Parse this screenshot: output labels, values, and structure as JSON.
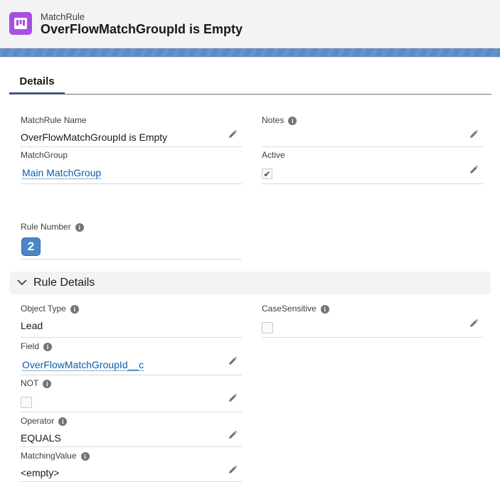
{
  "header": {
    "object_type": "MatchRule",
    "record_title": "OverFlowMatchGroupId is Empty",
    "icon": "matchrule-object-icon"
  },
  "tabs": [
    {
      "label": "Details",
      "active": true
    }
  ],
  "details": {
    "matchrule_name": {
      "label": "MatchRule Name",
      "value": "OverFlowMatchGroupId is Empty"
    },
    "notes": {
      "label": "Notes",
      "value": ""
    },
    "matchgroup": {
      "label": "MatchGroup",
      "value": "Main MatchGroup"
    },
    "active": {
      "label": "Active",
      "checked": true
    },
    "rule_number": {
      "label": "Rule Number",
      "value": "2"
    }
  },
  "rule_details": {
    "section_title": "Rule Details",
    "expanded": true,
    "object_type": {
      "label": "Object Type",
      "value": "Lead"
    },
    "case_sensitive": {
      "label": "CaseSensitive",
      "checked": false
    },
    "field": {
      "label": "Field",
      "value": "OverFlowMatchGroupId__c"
    },
    "not": {
      "label": "NOT",
      "checked": false
    },
    "operator": {
      "label": "Operator",
      "value": "EQUALS"
    },
    "matching_value": {
      "label": "MatchingValue",
      "value": "<empty>"
    }
  },
  "colors": {
    "object_icon_bg": "#a94de6",
    "link": "#0b5cab",
    "tab_underline": "#1b5297",
    "badge_bg": "#4c86c7"
  }
}
